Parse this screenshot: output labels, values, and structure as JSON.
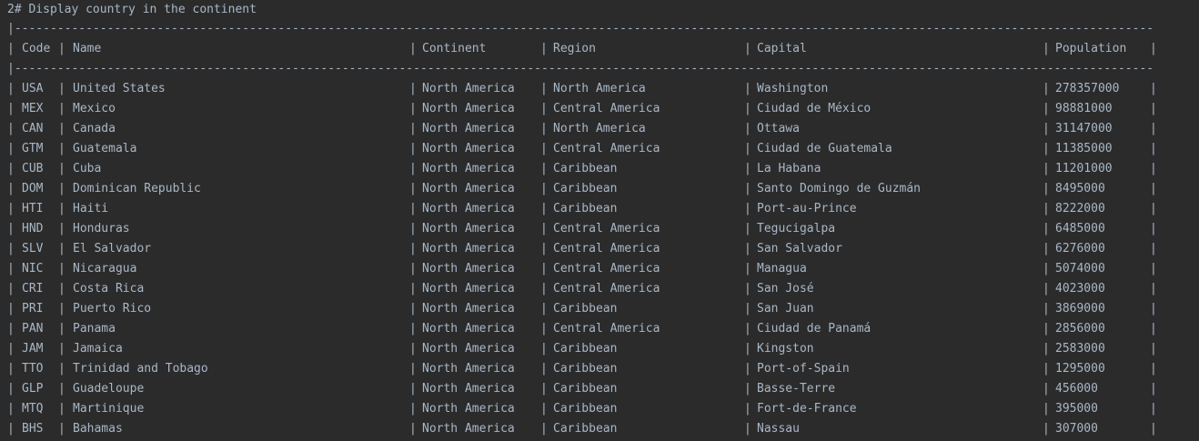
{
  "console": {
    "heading": "2# Display country in the continent",
    "border_line": "|--------------------------------------------------------------------------------------------------------------------------------------------------------------------------------------------------------------|",
    "headers": [
      "Code",
      "Name",
      "Continent",
      "Region",
      "Capital",
      "Population"
    ],
    "rows": [
      [
        "USA",
        "United States",
        "North America",
        "North America",
        "Washington",
        "278357000"
      ],
      [
        "MEX",
        "Mexico",
        "North America",
        "Central America",
        "Ciudad de México",
        "98881000"
      ],
      [
        "CAN",
        "Canada",
        "North America",
        "North America",
        "Ottawa",
        "31147000"
      ],
      [
        "GTM",
        "Guatemala",
        "North America",
        "Central America",
        "Ciudad de Guatemala",
        "11385000"
      ],
      [
        "CUB",
        "Cuba",
        "North America",
        "Caribbean",
        "La Habana",
        "11201000"
      ],
      [
        "DOM",
        "Dominican Republic",
        "North America",
        "Caribbean",
        "Santo Domingo de Guzmán",
        "8495000"
      ],
      [
        "HTI",
        "Haiti",
        "North America",
        "Caribbean",
        "Port-au-Prince",
        "8222000"
      ],
      [
        "HND",
        "Honduras",
        "North America",
        "Central America",
        "Tegucigalpa",
        "6485000"
      ],
      [
        "SLV",
        "El Salvador",
        "North America",
        "Central America",
        "San Salvador",
        "6276000"
      ],
      [
        "NIC",
        "Nicaragua",
        "North America",
        "Central America",
        "Managua",
        "5074000"
      ],
      [
        "CRI",
        "Costa Rica",
        "North America",
        "Central America",
        "San José",
        "4023000"
      ],
      [
        "PRI",
        "Puerto Rico",
        "North America",
        "Caribbean",
        "San Juan",
        "3869000"
      ],
      [
        "PAN",
        "Panama",
        "North America",
        "Central America",
        "Ciudad de Panamá",
        "2856000"
      ],
      [
        "JAM",
        "Jamaica",
        "North America",
        "Caribbean",
        "Kingston",
        "2583000"
      ],
      [
        "TTO",
        "Trinidad and Tobago",
        "North America",
        "Caribbean",
        "Port-of-Spain",
        "1295000"
      ],
      [
        "GLP",
        "Guadeloupe",
        "North America",
        "Caribbean",
        "Basse-Terre",
        "456000"
      ],
      [
        "MTQ",
        "Martinique",
        "North America",
        "Caribbean",
        "Fort-de-France",
        "395000"
      ],
      [
        "BHS",
        "Bahamas",
        "North America",
        "Caribbean",
        "Nassau",
        "307000"
      ]
    ]
  }
}
